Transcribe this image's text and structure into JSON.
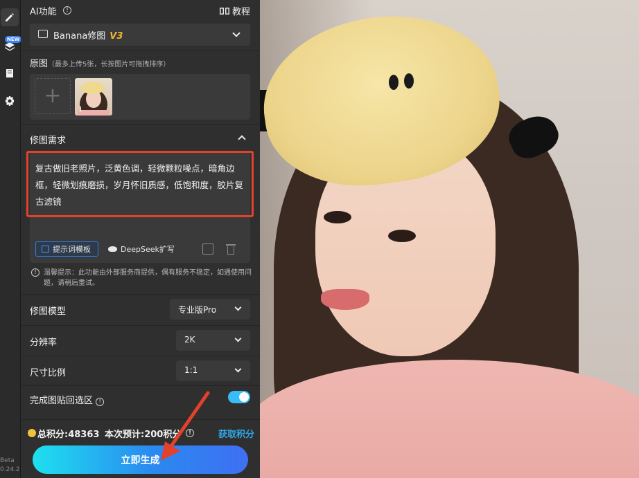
{
  "toolbar": {
    "items": [
      {
        "icon": "pen-icon",
        "active": true
      },
      {
        "icon": "layers-icon",
        "badge": "NEW"
      },
      {
        "icon": "book-icon"
      },
      {
        "icon": "gear-icon"
      }
    ],
    "version_line1": "Beta",
    "version_line2": "0.24.2"
  },
  "panel": {
    "ai_title": "AI功能",
    "info_glyph": "!",
    "tutorial_label": "教程",
    "model": {
      "name": "Banana修图",
      "version": "V3"
    },
    "original": {
      "label": "原图",
      "hint": "（最多上传5张，长按图片可拖拽排序）",
      "plus": "+",
      "thumb_index": "1"
    },
    "requirement": {
      "title": "修图需求",
      "text": "复古做旧老照片，泛黄色调，轻微颗粒噪点，暗角边框，轻微划痕磨损，岁月怀旧质感，低饱和度，胶片复古滤镜",
      "template_button": "提示词模板",
      "deepseek_button": "DeepSeek扩写"
    },
    "warning": "温馨提示：此功能由外部服务商提供，偶有服务不稳定，如遇使用问题，请稍后重试。",
    "settings": {
      "model_label": "修图模型",
      "model_value": "专业版Pro",
      "resolution_label": "分辨率",
      "resolution_value": "2K",
      "ratio_label": "尺寸比例",
      "ratio_value": "1:1",
      "paste_back_label": "完成图贴回选区",
      "paste_back_enabled": true
    },
    "points": {
      "total": "总积分:48363",
      "estimate": "本次预计:200积分",
      "get_points": "获取积分"
    },
    "generate_button": "立即生成"
  },
  "colors": {
    "accent_blue": "#2f7fe0",
    "highlight_red": "#e2412c",
    "version_yellow": "#f5b82e",
    "toggle_on": "#38bdf8",
    "link_blue": "#2fa7e8"
  }
}
